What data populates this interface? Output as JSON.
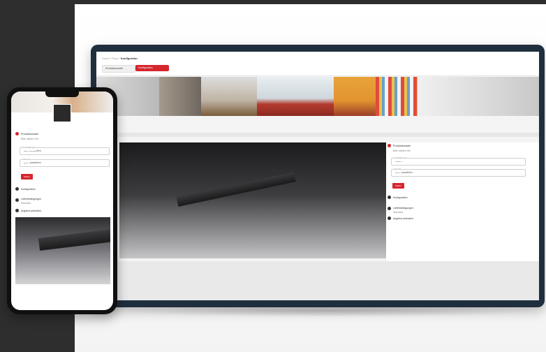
{
  "tablet": {
    "breadcrumb_prefix": "Home / Shop /",
    "breadcrumb_current": "Konfigurator",
    "chip_left": "Produktauswahl",
    "chip_right": "Konfiguration",
    "steps": [
      {
        "title": "Produktauswahl",
        "sub": "Bitte wählen Sie"
      },
      {
        "title": "Konfiguration",
        "sub": ""
      },
      {
        "title": "Lieferbedingungen",
        "sub": "Standard"
      },
      {
        "title": "Angebot anfordern",
        "sub": ""
      }
    ],
    "select1_label": "Produktgruppe",
    "select1_value": "Latten",
    "select2_label": "Variante",
    "select2_value": "Bitte auswählen",
    "button_label": "Weiter"
  },
  "phone": {
    "steps": [
      {
        "title": "Produktauswahl",
        "sub": "Bitte wählen Sie"
      },
      {
        "title": "Konfiguration",
        "sub": ""
      },
      {
        "title": "Lieferbedingungen",
        "sub": "Standard"
      },
      {
        "title": "Angebot anfordern",
        "sub": ""
      }
    ],
    "select1_label": "Produktgruppe",
    "select1_value": "Bitte auswählen",
    "select2_label": "Variante",
    "select2_value": "Bitte auswählen",
    "button_label": "Weiter"
  },
  "colors": {
    "accent": "#d6262e",
    "device_frame": "#1f2f3e",
    "background": "#2e2e2e"
  }
}
